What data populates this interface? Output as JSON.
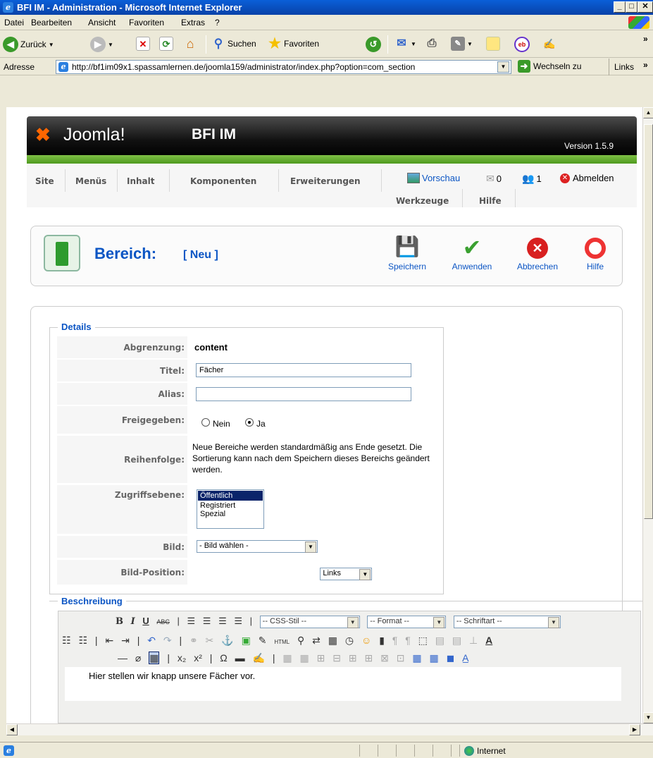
{
  "window": {
    "title": "BFI IM - Administration - Microsoft Internet Explorer"
  },
  "menubar": {
    "items": [
      "Datei",
      "Bearbeiten",
      "Ansicht",
      "Favoriten",
      "Extras",
      "?"
    ]
  },
  "toolbar": {
    "back": "Zurück",
    "search": "Suchen",
    "favorites": "Favoriten"
  },
  "address": {
    "label": "Adresse",
    "url": "http://bf1im09x1.spassamlernen.de/joomla159/administrator/index.php?option=com_section",
    "go": "Wechseln zu",
    "links": "Links"
  },
  "joomla": {
    "brand": "Joomla!",
    "site": "BFI IM",
    "version": "Version 1.5.9",
    "menu": [
      "Site",
      "Menüs",
      "Inhalt",
      "Komponenten",
      "Erweiterungen",
      "Werkzeuge",
      "Hilfe"
    ],
    "status": {
      "preview": "Vorschau",
      "messages": "0",
      "users": "1",
      "logout": "Abmelden"
    }
  },
  "page": {
    "title": "Bereich:",
    "subtitle": "[ Neu ]",
    "actions": [
      "Speichern",
      "Anwenden",
      "Abbrechen",
      "Hilfe"
    ]
  },
  "details": {
    "legend": "Details",
    "scope_label": "Abgrenzung:",
    "scope_value": "content",
    "title_label": "Titel:",
    "title_value": "Fächer",
    "alias_label": "Alias:",
    "alias_value": "",
    "published_label": "Freigegeben:",
    "published_no": "Nein",
    "published_yes": "Ja",
    "order_label": "Reihenfolge:",
    "order_text": "Neue Bereiche werden standardmäßig ans Ende gesetzt. Die Sortierung kann nach dem Speichern dieses Bereichs geändert werden.",
    "access_label": "Zugriffsebene:",
    "access_options": [
      "Öffentlich",
      "Registriert",
      "Spezial"
    ],
    "image_label": "Bild:",
    "image_value": "- Bild wählen -",
    "imagepos_label": "Bild-Position:",
    "imagepos_value": "Links"
  },
  "description": {
    "legend": "Beschreibung",
    "css": "-- CSS-Stil --",
    "format": "-- Format --",
    "font": "-- Schriftart --",
    "text": "Hier stellen wir knapp unsere Fächer vor."
  },
  "statusbar": {
    "zone": "Internet"
  }
}
